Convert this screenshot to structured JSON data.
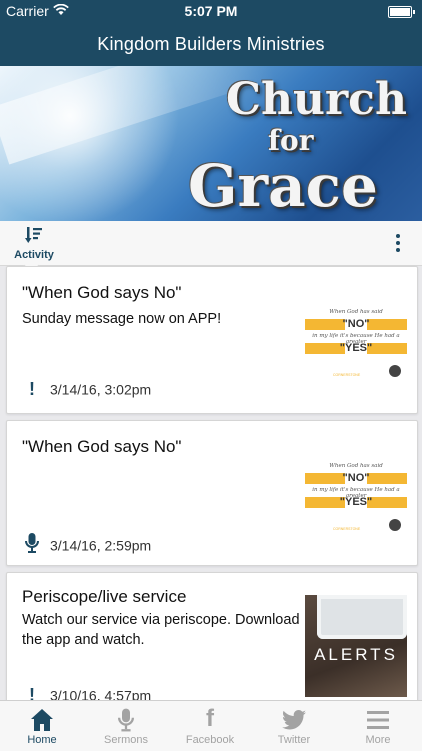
{
  "status": {
    "carrier": "Carrier",
    "time": "5:07 PM"
  },
  "nav": {
    "title": "Kingdom Builders Ministries"
  },
  "banner": {
    "line1": "Church",
    "line2": "for",
    "line3": "Grace"
  },
  "activity": {
    "tab_label": "Activity",
    "tab_icon": "sort-icon",
    "more_icon": "more-vertical-icon"
  },
  "cards": [
    {
      "title": "\"When God says No\"",
      "body": "Sunday message now on APP!",
      "meta_icon": "!",
      "timestamp": "3/14/16, 3:02pm",
      "thumb": {
        "top": "When God has said",
        "no": "\"NO\"",
        "mid": "in my life it's because He had a greater",
        "yes": "\"YES\"",
        "foot": "CORNERSTONE"
      }
    },
    {
      "title": "\"When God says No\"",
      "body": "",
      "meta_icon": "🎙",
      "timestamp": "3/14/16, 2:59pm",
      "thumb": {
        "top": "When God has said",
        "no": "\"NO\"",
        "mid": "in my life it's because He had a greater",
        "yes": "\"YES\"",
        "foot": "CORNERSTONE"
      }
    },
    {
      "title": "Periscope/live service",
      "body": "Watch our service via periscope. Download the app and watch.",
      "meta_icon": "!",
      "timestamp": "3/10/16, 4:57pm",
      "thumb_label": "ALERTS"
    }
  ],
  "tabs": [
    {
      "label": "Home",
      "icon": "home-icon",
      "glyph": "⌂",
      "active": true
    },
    {
      "label": "Sermons",
      "icon": "microphone-icon",
      "glyph": "🎙",
      "active": false
    },
    {
      "label": "Facebook",
      "icon": "facebook-icon",
      "glyph": "f",
      "active": false
    },
    {
      "label": "Twitter",
      "icon": "twitter-icon",
      "glyph": "🐦",
      "active": false
    },
    {
      "label": "More",
      "icon": "menu-icon",
      "glyph": "☰",
      "active": false
    }
  ],
  "colors": {
    "primary": "#1d4a63",
    "accent": "#f4b733",
    "inactive": "#a3a3a3"
  }
}
